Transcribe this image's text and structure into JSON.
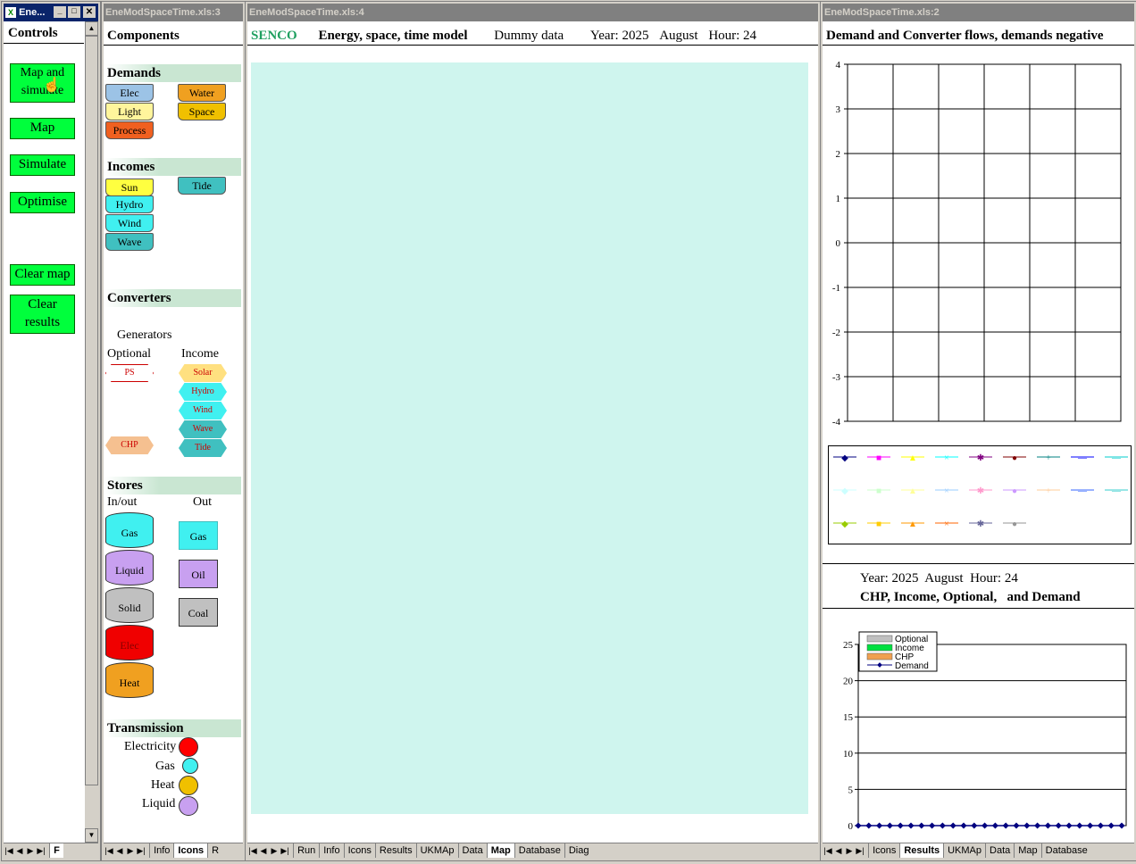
{
  "controls": {
    "title": "Ene...",
    "header": "Controls",
    "buttons": [
      "Map and simulate",
      "Map",
      "Simulate",
      "Optimise",
      "Clear map",
      "Clear results"
    ],
    "tabs": [
      "F"
    ]
  },
  "components": {
    "title": "EneModSpaceTime.xls:3",
    "header": "Components",
    "demands": {
      "title": "Demands",
      "items": [
        "Elec",
        "Water",
        "Light",
        "Space",
        "Process"
      ]
    },
    "incomes": {
      "title": "Incomes",
      "items": [
        "Sun",
        "Tide",
        "Hydro",
        "Wind",
        "Wave"
      ]
    },
    "converters": {
      "title": "Converters",
      "generators": "Generators",
      "optional": "Optional",
      "income": "Income",
      "optional_items": [
        "PS",
        "CHP"
      ],
      "income_items": [
        "Solar",
        "Hydro",
        "Wind",
        "Wave",
        "Tide"
      ]
    },
    "stores": {
      "title": "Stores",
      "inout": "In/out",
      "out": "Out",
      "in_items": [
        "Gas",
        "Liquid",
        "Solid",
        "Elec",
        "Heat"
      ],
      "out_items": [
        "Gas",
        "Oil",
        "Coal"
      ]
    },
    "transmission": {
      "title": "Transmission",
      "items": [
        "Electricity",
        "Gas",
        "Heat",
        "Liquid"
      ]
    },
    "tabs": [
      "Info",
      "Icons",
      "R"
    ]
  },
  "map": {
    "title": "EneModSpaceTime.xls:4",
    "brand": "SENCO",
    "model": "Energy, space, time model",
    "data": "Dummy data",
    "year": "Year: 2025",
    "month": "August",
    "hour": "Hour: 24",
    "tabs": [
      "Run",
      "Info",
      "Icons",
      "Results",
      "UKMAp",
      "Data",
      "Map",
      "Database",
      "Diag"
    ],
    "active_tab": "Map"
  },
  "results": {
    "title": "EneModSpaceTime.xls:2",
    "chart1_title": "Demand and Converter flows, demands negative",
    "year_line": "Year: 2025  August  Hour: 24",
    "chart2_title": "CHP, Income, Optional,   and Demand",
    "tabs": [
      "Icons",
      "Results",
      "UKMAp",
      "Data",
      "Map",
      "Database"
    ],
    "active_tab": "Results"
  },
  "chart_data": [
    {
      "type": "line",
      "title": "Demand and Converter flows, demands negative",
      "ylim": [
        -4,
        4
      ],
      "yticks": [
        "4",
        "3",
        "2",
        "1",
        "0",
        "-1",
        "-2",
        "-3",
        "-4"
      ],
      "grid": true,
      "series": []
    },
    {
      "type": "area",
      "title": "CHP, Income, Optional,   and Demand",
      "ylim": [
        0,
        25
      ],
      "yticks": [
        "25",
        "20",
        "15",
        "10",
        "5",
        "0"
      ],
      "xticks": [
        "0",
        "0",
        "0",
        "0",
        "0",
        "0"
      ],
      "legend": "top-left",
      "series": [
        {
          "name": "Optional",
          "color": "#c0c0c0"
        },
        {
          "name": "Income",
          "color": "#00e040"
        },
        {
          "name": "CHP",
          "color": "#f0a050"
        },
        {
          "name": "Demand",
          "color": "#000080",
          "values": [
            0,
            0,
            0,
            0,
            0,
            0,
            0,
            0,
            0,
            0,
            0,
            0,
            0,
            0,
            0,
            0,
            0,
            0,
            0,
            0,
            0,
            0,
            0,
            0,
            0,
            0
          ]
        }
      ]
    }
  ]
}
